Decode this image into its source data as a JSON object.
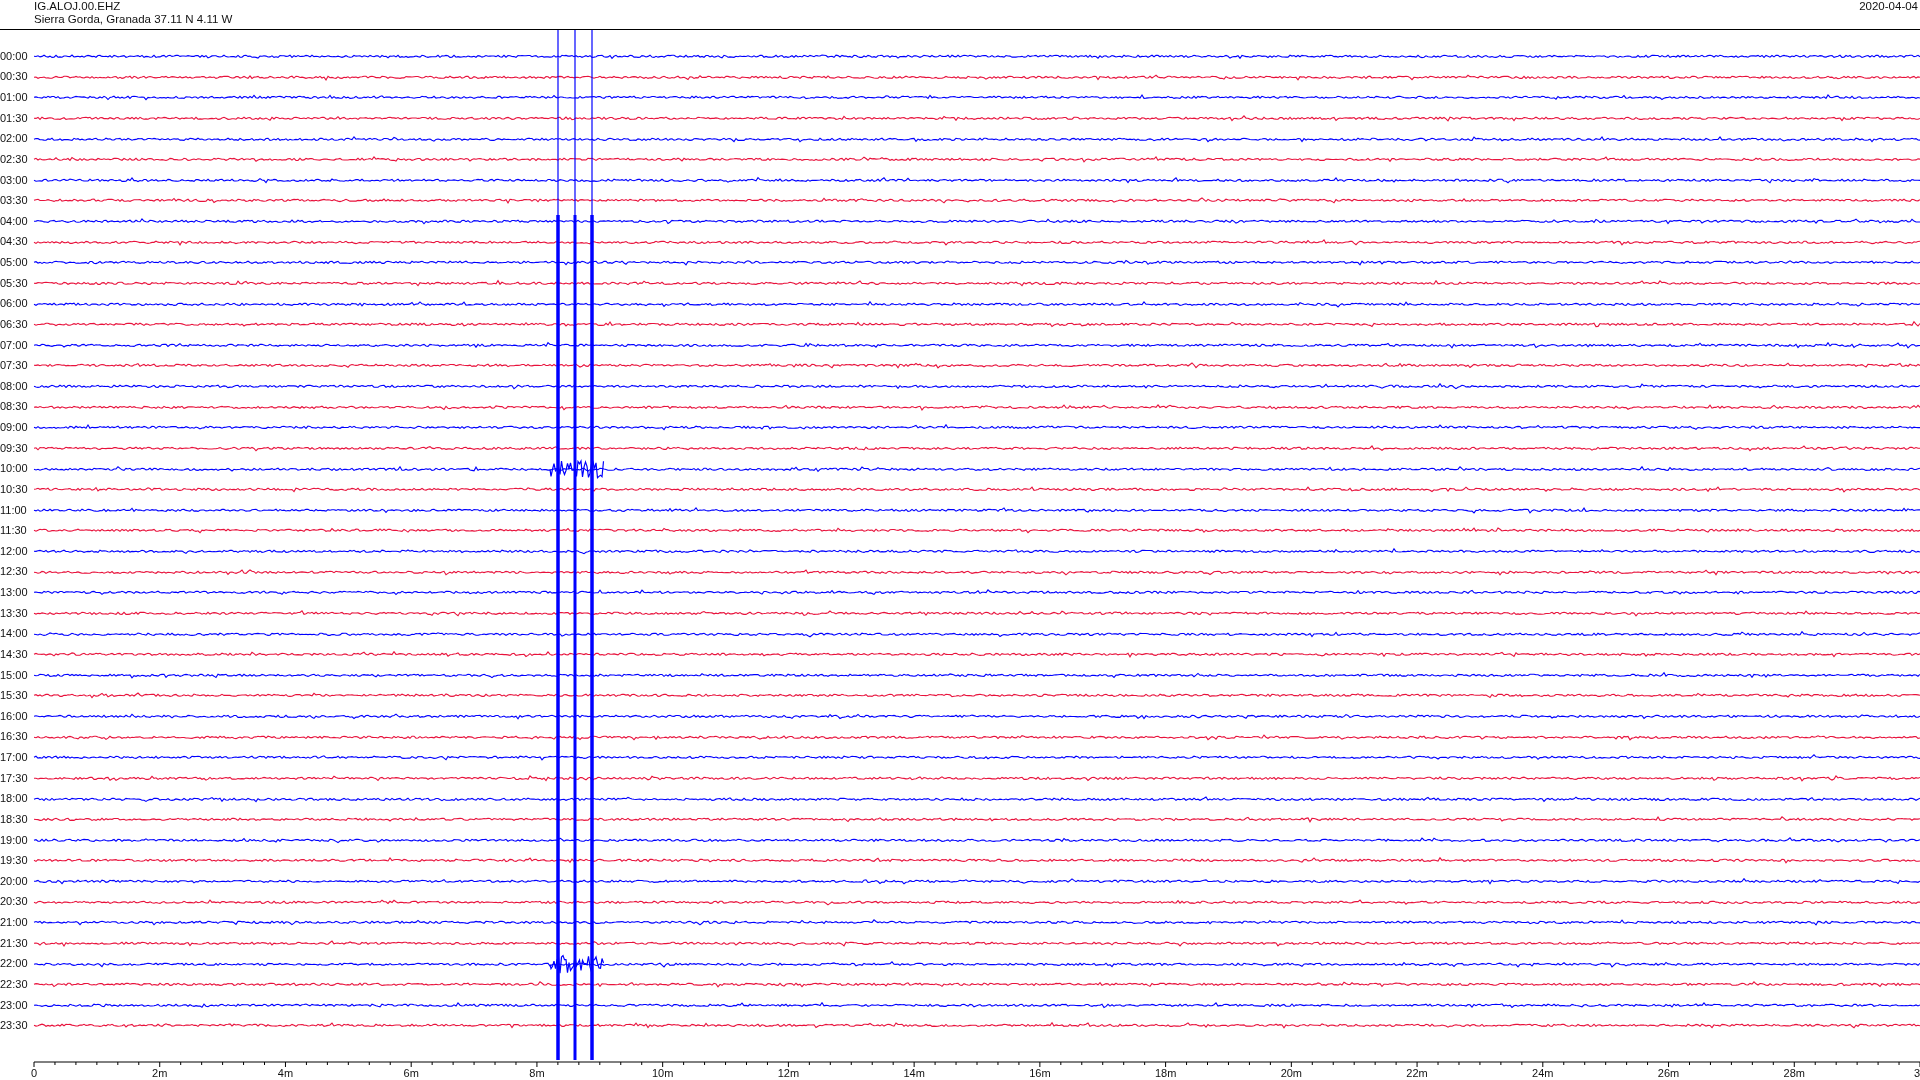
{
  "header": {
    "station": "IG.ALOJ.00.EHZ",
    "location": "Sierra Gorda, Granada  37.11 N 4.11 W",
    "date": "2020-04-04"
  },
  "rows": [
    {
      "label": "00:00",
      "color": "#0000ff"
    },
    {
      "label": "00:30",
      "color": "#e8123c"
    },
    {
      "label": "01:00",
      "color": "#0000ff"
    },
    {
      "label": "01:30",
      "color": "#e8123c"
    },
    {
      "label": "02:00",
      "color": "#0000ff"
    },
    {
      "label": "02:30",
      "color": "#e8123c"
    },
    {
      "label": "03:00",
      "color": "#0000ff"
    },
    {
      "label": "03:30",
      "color": "#e8123c"
    },
    {
      "label": "04:00",
      "color": "#0000ff"
    },
    {
      "label": "04:30",
      "color": "#e8123c"
    },
    {
      "label": "05:00",
      "color": "#0000ff"
    },
    {
      "label": "05:30",
      "color": "#e8123c"
    },
    {
      "label": "06:00",
      "color": "#0000ff"
    },
    {
      "label": "06:30",
      "color": "#e8123c"
    },
    {
      "label": "07:00",
      "color": "#0000ff"
    },
    {
      "label": "07:30",
      "color": "#e8123c"
    },
    {
      "label": "08:00",
      "color": "#0000ff"
    },
    {
      "label": "08:30",
      "color": "#e8123c"
    },
    {
      "label": "09:00",
      "color": "#0000ff"
    },
    {
      "label": "09:30",
      "color": "#e8123c"
    },
    {
      "label": "10:00",
      "color": "#0000ff"
    },
    {
      "label": "10:30",
      "color": "#e8123c"
    },
    {
      "label": "11:00",
      "color": "#0000ff"
    },
    {
      "label": "11:30",
      "color": "#e8123c"
    },
    {
      "label": "12:00",
      "color": "#0000ff"
    },
    {
      "label": "12:30",
      "color": "#e8123c"
    },
    {
      "label": "13:00",
      "color": "#0000ff"
    },
    {
      "label": "13:30",
      "color": "#e8123c"
    },
    {
      "label": "14:00",
      "color": "#0000ff"
    },
    {
      "label": "14:30",
      "color": "#e8123c"
    },
    {
      "label": "15:00",
      "color": "#0000ff"
    },
    {
      "label": "15:30",
      "color": "#e8123c"
    },
    {
      "label": "16:00",
      "color": "#0000ff"
    },
    {
      "label": "16:30",
      "color": "#e8123c"
    },
    {
      "label": "17:00",
      "color": "#0000ff"
    },
    {
      "label": "17:30",
      "color": "#e8123c"
    },
    {
      "label": "18:00",
      "color": "#0000ff"
    },
    {
      "label": "18:30",
      "color": "#e8123c"
    },
    {
      "label": "19:00",
      "color": "#0000ff"
    },
    {
      "label": "19:30",
      "color": "#e8123c"
    },
    {
      "label": "20:00",
      "color": "#0000ff"
    },
    {
      "label": "20:30",
      "color": "#e8123c"
    },
    {
      "label": "21:00",
      "color": "#0000ff"
    },
    {
      "label": "21:30",
      "color": "#e8123c"
    },
    {
      "label": "22:00",
      "color": "#0000ff"
    },
    {
      "label": "22:30",
      "color": "#e8123c"
    },
    {
      "label": "23:00",
      "color": "#0000ff"
    },
    {
      "label": "23:30",
      "color": "#e8123c"
    }
  ],
  "axis": {
    "tick_labels": [
      "0",
      "2m",
      "4m",
      "6m",
      "8m",
      "10m",
      "12m",
      "14m",
      "16m",
      "18m",
      "20m",
      "22m",
      "24m",
      "26m",
      "28m",
      "3"
    ]
  }
}
